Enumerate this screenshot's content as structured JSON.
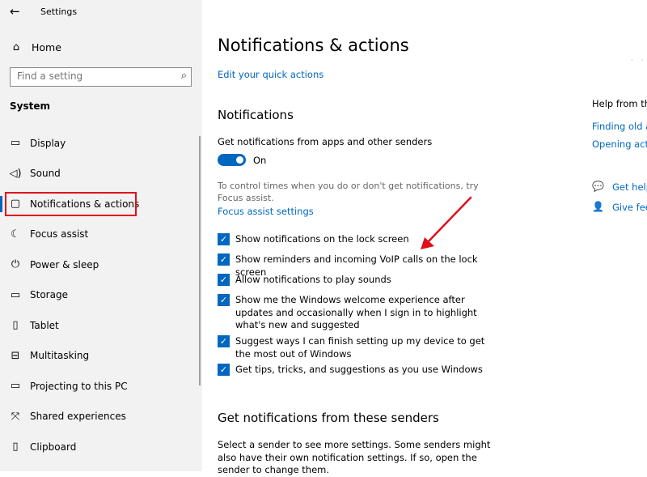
{
  "window": {
    "title": "Settings",
    "back_icon": "back-arrow-icon"
  },
  "sidebar": {
    "home_label": "Home",
    "search": {
      "placeholder": "Find a setting"
    },
    "section_label": "System",
    "items": [
      {
        "label": "Display",
        "icon": "display-icon",
        "glyph": "▭"
      },
      {
        "label": "Sound",
        "icon": "speaker-icon",
        "glyph": "◁)"
      },
      {
        "label": "Notifications & actions",
        "icon": "notification-icon",
        "glyph": "▢",
        "active": true
      },
      {
        "label": "Focus assist",
        "icon": "moon-icon",
        "glyph": "☾"
      },
      {
        "label": "Power & sleep",
        "icon": "power-icon",
        "glyph": "⏻"
      },
      {
        "label": "Storage",
        "icon": "storage-icon",
        "glyph": "▭"
      },
      {
        "label": "Tablet",
        "icon": "tablet-icon",
        "glyph": "▯"
      },
      {
        "label": "Multitasking",
        "icon": "multitasking-icon",
        "glyph": "⊟"
      },
      {
        "label": "Projecting to this PC",
        "icon": "projecting-icon",
        "glyph": "▭"
      },
      {
        "label": "Shared experiences",
        "icon": "shared-experiences-icon",
        "glyph": "⤧"
      },
      {
        "label": "Clipboard",
        "icon": "clipboard-icon",
        "glyph": "▯"
      }
    ]
  },
  "main": {
    "title": "Notifications & actions",
    "quick_actions_link": "Edit your quick actions",
    "notifications_heading": "Notifications",
    "get_notifications_label": "Get notifications from apps and other senders",
    "toggle_state": "On",
    "focus_text": "To control times when you do or don't get notifications, try Focus assist.",
    "focus_link": "Focus assist settings",
    "checkboxes": [
      {
        "label": "Show notifications on the lock screen",
        "checked": true
      },
      {
        "label": "Show reminders and incoming VoIP calls on the lock screen",
        "checked": true
      },
      {
        "label": "Allow notifications to play sounds",
        "checked": true
      },
      {
        "label": "Show me the Windows welcome experience after updates and occasionally when I sign in to highlight what's new and suggested",
        "checked": true
      },
      {
        "label": "Suggest ways I can finish setting up my device to get the most out of Windows",
        "checked": true
      },
      {
        "label": "Get tips, tricks, and suggestions as you use Windows",
        "checked": true
      }
    ],
    "senders_heading": "Get notifications from these senders",
    "senders_text": "Select a sender to see more settings. Some senders might also have their own notification settings. If so, open the sender to change them."
  },
  "right_panel": {
    "help_heading": "Help from the",
    "links": [
      "Finding old a",
      "Opening actio"
    ],
    "get_help": "Get help",
    "give_feedback": "Give feed"
  },
  "colors": {
    "accent": "#0067c0",
    "sidebar_bg": "#f2f2f2",
    "highlight_box": "#e0101c",
    "annotation_arrow": "#e0101c"
  }
}
